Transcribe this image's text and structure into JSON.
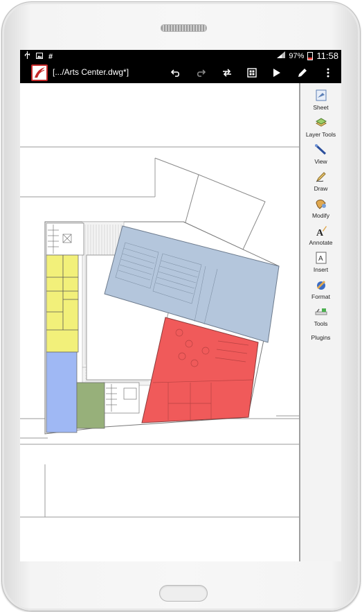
{
  "status_bar": {
    "left_icons": [
      "usb-icon",
      "image-icon",
      "hash-icon"
    ],
    "battery_percent": "97%",
    "time": "11:58"
  },
  "action_bar": {
    "file_name": "[.../Arts Center.dwg*]",
    "actions": [
      "undo",
      "redo",
      "swap",
      "grid",
      "play",
      "pen",
      "overflow-menu"
    ]
  },
  "toolbar": {
    "items": [
      {
        "label": "Sheet",
        "icon": "sheet-icon"
      },
      {
        "label": "Layer Tools",
        "icon": "layer-tools-icon"
      },
      {
        "label": "View",
        "icon": "view-icon"
      },
      {
        "label": "Draw",
        "icon": "draw-icon"
      },
      {
        "label": "Modify",
        "icon": "modify-icon"
      },
      {
        "label": "Annotate",
        "icon": "annotate-icon"
      },
      {
        "label": "Insert",
        "icon": "insert-icon"
      },
      {
        "label": "Format",
        "icon": "format-icon"
      },
      {
        "label": "Tools",
        "icon": "tools-icon"
      }
    ],
    "plugins_label": "Plugins"
  },
  "drawing": {
    "colors": {
      "auditorium": "#b4c6dc",
      "stage": "#f05a5a",
      "offices": "#f2f07a",
      "blue_block": "#9fb8f4",
      "green_block": "#97b07a"
    }
  }
}
